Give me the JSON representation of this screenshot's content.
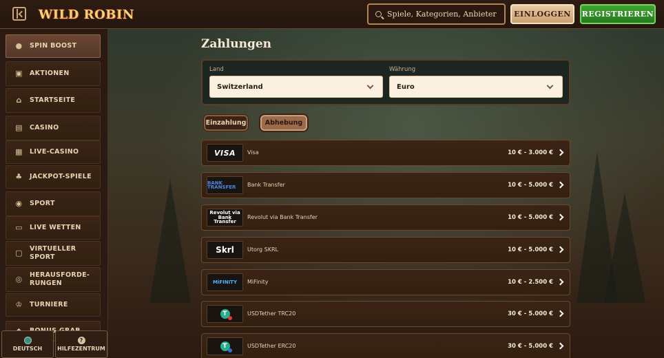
{
  "header": {
    "logo_text": "WILD ROBIN",
    "search_placeholder": "Spiele, Kategorien, Anbieter",
    "login_label": "EINLOGGEN",
    "register_label": "REGISTRIEREN"
  },
  "sidebar": {
    "items": [
      {
        "label": "SPIN BOOST",
        "icon": "spin-boost-icon"
      },
      {
        "label": "AKTIONEN",
        "icon": "gift-icon"
      },
      {
        "label": "STARTSEITE",
        "icon": "home-icon"
      },
      {
        "label": "CASINO",
        "icon": "casino-icon"
      },
      {
        "label": "LIVE-CASINO",
        "icon": "live-casino-icon"
      },
      {
        "label": "JACKPOT-SPIELE",
        "icon": "clover-icon"
      },
      {
        "label": "SPORT",
        "icon": "ball-icon"
      },
      {
        "label": "LIVE WETTEN",
        "icon": "live-icon"
      },
      {
        "label": "VIRTUELLER SPORT",
        "icon": "monitor-icon"
      },
      {
        "label": "HERAUSFORDE-RUNGEN",
        "icon": "target-icon"
      },
      {
        "label": "TURNIERE",
        "icon": "trophy-icon"
      },
      {
        "label": "BONUS GRAB",
        "icon": "bonus-icon"
      }
    ],
    "language_label": "DEUTSCH",
    "help_label": "HILFEZENTRUM"
  },
  "main": {
    "title": "Zahlungen",
    "country_label": "Land",
    "country_value": "Switzerland",
    "currency_label": "Währung",
    "currency_value": "Euro",
    "tabs": [
      {
        "label": "Einzahlung"
      },
      {
        "label": "Abhebung"
      }
    ],
    "methods": [
      {
        "name": "Visa",
        "range": "10 € - 3.000 €",
        "logo": "VISA"
      },
      {
        "name": "Bank Transfer",
        "range": "10 € - 5.000 €",
        "logo": "BANK TRANSFER"
      },
      {
        "name": "Revolut via Bank Transfer",
        "range": "10 € - 5.000 €",
        "logo": "Revolut via Bank Transfer"
      },
      {
        "name": "Utorg SKRL",
        "range": "10 € - 5.000 €",
        "logo": "Skrl"
      },
      {
        "name": "MiFinity",
        "range": "10 € - 2.500 €",
        "logo": "MiFINITY"
      },
      {
        "name": "USDTether TRC20",
        "range": "30 € - 5.000 €",
        "logo": "T"
      },
      {
        "name": "USDTether ERC20",
        "range": "30 € - 5.000 €",
        "logo": "T"
      }
    ]
  },
  "colors": {
    "accent_green": "#3fa531",
    "accent_gold": "#e9c9a0",
    "panel_brown": "#3b2416"
  }
}
